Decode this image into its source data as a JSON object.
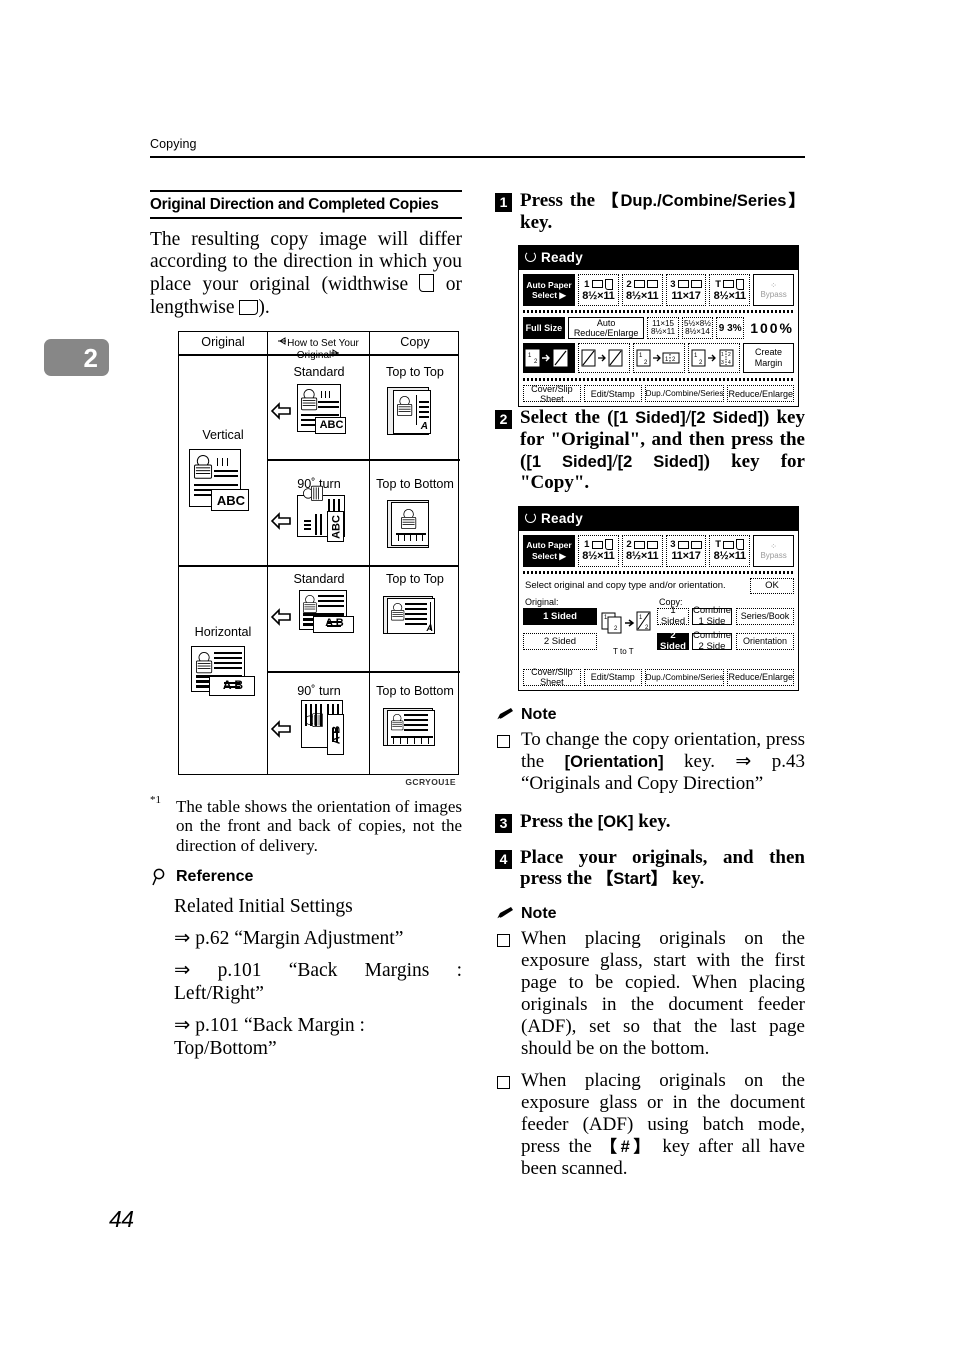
{
  "header": {
    "running_head": "Copying"
  },
  "chapter_tab": {
    "number": "2"
  },
  "folio": {
    "page_number": "44"
  },
  "left_column": {
    "section_title": "Original Direction and Completed Copies",
    "intro_part1": "The resulting copy image will differ according to the direction in which you place your original (widthwise ",
    "intro_part2": " or lengthwise ",
    "intro_part3": ").",
    "figure": {
      "col_headers": {
        "original": "Original",
        "how_to_set": "How to Set Your Original",
        "copy": "Copy"
      },
      "rows": [
        {
          "orientation": "Vertical",
          "orig_caption": "ABC",
          "sub": [
            {
              "set": "Standard",
              "result": "Top to Top"
            },
            {
              "set": "90˚ turn",
              "result": "Top to Bottom"
            }
          ]
        },
        {
          "orientation": "Horizontal",
          "orig_caption": "A     B",
          "sub": [
            {
              "set": "Standard",
              "result": "Top to Top"
            },
            {
              "set": "90˚ turn",
              "result": "Top to Bottom"
            }
          ]
        }
      ],
      "figure_id": "GCRYOU1E"
    },
    "footnote": {
      "marker": "*1",
      "text": "The table shows the orientation of images on the front and back of copies, not the direction of delivery."
    },
    "reference": {
      "heading": "Reference",
      "lead": "Related Initial Settings",
      "links": [
        "⇒ p.62 “Margin Adjustment”",
        "⇒ p.101 “Back Margins : Left/Right”",
        "⇒ p.101 “Back Margin : Top/Bottom”"
      ]
    }
  },
  "right_column": {
    "steps": [
      {
        "number": "1",
        "text_before": "Press   the   ",
        "key": "【Dup./Combine/Series】",
        "text_after": " key."
      },
      {
        "number": "2",
        "text_a": "Select the (",
        "key_a": "[1 Sided]",
        "slash": "/",
        "key_b": "[2 Sided]",
        "text_b": ") key for \"Original\", and then press the (",
        "key_c": "[1 Sided]",
        "key_d": "[2 Sided]",
        "text_c": ") key for \"Copy\"."
      },
      {
        "number": "3",
        "text_before": "Press the ",
        "key": "[OK]",
        "text_after": " key."
      },
      {
        "number": "4",
        "text_before": "Place your originals, and then press the ",
        "key": "【Start】",
        "text_after": " key."
      }
    ],
    "note1": {
      "heading": "Note",
      "items": [
        {
          "text_a": "To change the copy orientation, press the ",
          "key": "[Orientation]",
          "text_b": " key. ⇒ p.43 “Originals and Copy Direction”"
        }
      ]
    },
    "note2": {
      "heading": "Note",
      "items": [
        {
          "text": "When placing originals on the exposure glass, start with the first page to be copied. When placing originals in the document feeder (ADF), set so that the last page should be on the bottom."
        },
        {
          "text_a": "When placing originals on the exposure glass or in the document feeder (ADF) using batch mode, press the ",
          "key": "【#】",
          "text_b": " key after all have been scanned."
        }
      ]
    },
    "lcd1": {
      "status": "Ready",
      "auto_paper_select": "Auto Paper Select ▶",
      "trays": [
        {
          "num": "1",
          "size": "8½×11",
          "dir": "port"
        },
        {
          "num": "2",
          "size": "8½×11",
          "dir": "land"
        },
        {
          "num": "3",
          "size": "11×17",
          "dir": "land"
        },
        {
          "num": "T",
          "size": "8½×11",
          "dir": "port"
        }
      ],
      "bypass_label": "Bypass",
      "zoom_row": {
        "full_size": "Full Size",
        "auto_reduce": "Auto Reduce/Enlarge",
        "preset1_top": "11×15",
        "preset1_bot": "8½×11",
        "preset2_top": "5½×8½",
        "preset2_bot": "8½×14",
        "preset3": "9 3%",
        "current": "100%"
      },
      "duplex_row": {
        "b1": "1 2 → 1/2",
        "b2": "1/2 → 1/2",
        "b3": "1 2 → 1 2",
        "b4": "1 2 → 1 2 3 4",
        "b5_l1": "Create",
        "b5_l2": "Margin"
      },
      "tabs": [
        "Cover/Slip Sheet",
        "Edit/Stamp",
        "Dup./Combine/Series",
        "Reduce/Enlarge"
      ]
    },
    "lcd2": {
      "status": "Ready",
      "auto_paper_select": "Auto Paper Select ▶",
      "trays": [
        {
          "num": "1",
          "size": "8½×11",
          "dir": "port"
        },
        {
          "num": "2",
          "size": "8½×11",
          "dir": "land"
        },
        {
          "num": "3",
          "size": "11×17",
          "dir": "land"
        },
        {
          "num": "T",
          "size": "8½×11",
          "dir": "port"
        }
      ],
      "bypass_label": "Bypass",
      "message": "Select original and copy type and/or orientation.",
      "ok_label": "OK",
      "original_label": "Original:",
      "copy_label": "Copy:",
      "original_options": [
        "1 Sided",
        "2 Sided"
      ],
      "original_selected": "1 Sided",
      "copy_options_col1": [
        "1 Sided",
        "2 Sided"
      ],
      "copy_options_col2": [
        "Combine 1 Side",
        "Combine 2 Side"
      ],
      "copy_selected": "2 Sided",
      "side_buttons": [
        "Series/Book",
        "Orientation"
      ],
      "preview_caption": "T to T",
      "tabs": [
        "Cover/Slip Sheet",
        "Edit/Stamp",
        "Dup./Combine/Series",
        "Reduce/Enlarge"
      ]
    }
  }
}
